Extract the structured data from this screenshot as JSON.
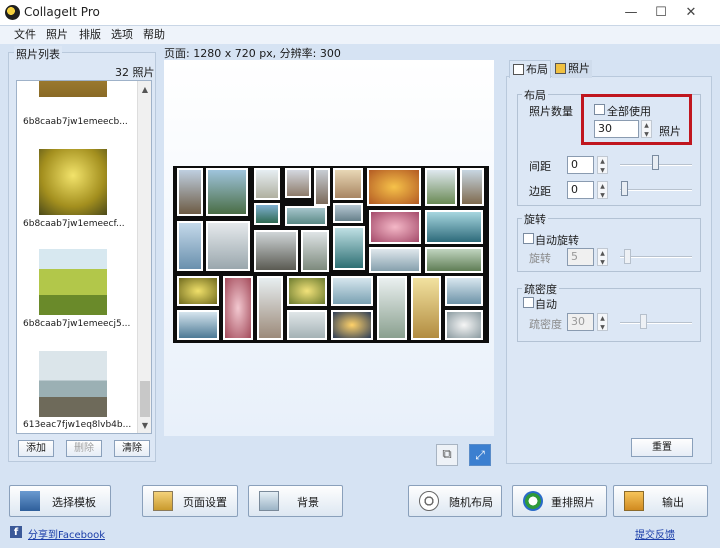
{
  "window": {
    "title": "CollageIt Pro",
    "minimize": "—",
    "maximize": "☐",
    "close": "✕"
  },
  "menu": [
    "文件",
    "照片",
    "排版",
    "选项",
    "帮助"
  ],
  "photo_panel": {
    "title": "照片列表",
    "count": "32 照片",
    "items": [
      {
        "caption": "6b8caab7jw1emeecb..."
      },
      {
        "caption": "6b8caab7jw1emeecf..."
      },
      {
        "caption": "6b8caab7jw1emeecj5..."
      },
      {
        "caption": "613eac7fjw1eq8lvb4b..."
      }
    ],
    "add_label": "添加",
    "delete_label": "删除",
    "clear_label": "清除"
  },
  "page_info": "页面: 1280 x 720 px, 分辨率: 300",
  "tabs": {
    "layout": "布局",
    "photo": "照片"
  },
  "layout_group": {
    "title": "布局",
    "photo_count_label": "照片数量",
    "use_all_label": "全部使用",
    "photo_count_value": "30",
    "photo_unit": "照片",
    "spacing_label": "间距",
    "spacing_value": "0",
    "margin_label": "边距",
    "margin_value": "0"
  },
  "rotation_group": {
    "title": "旋转",
    "auto_label": "自动旋转",
    "rotate_label": "旋转",
    "rotate_value": "5"
  },
  "density_group": {
    "title": "疏密度",
    "auto_label": "自动",
    "density_label": "疏密度",
    "density_value": "30"
  },
  "reset_label": "重置",
  "bottom_buttons": {
    "template": "选择模板",
    "page_setup": "页面设置",
    "background": "背景",
    "random_layout": "随机布局",
    "rearrange": "重排照片",
    "output": "输出"
  },
  "links": {
    "share": "分享到Facebook",
    "feedback": "提交反馈"
  },
  "colors": {
    "highlight": "#c0161e",
    "accent": "#1a3da8"
  }
}
